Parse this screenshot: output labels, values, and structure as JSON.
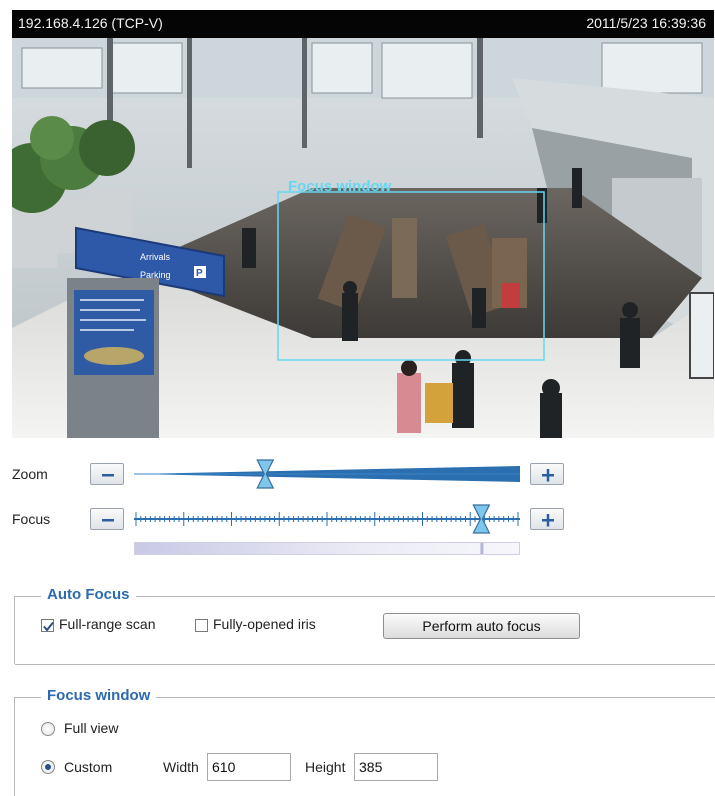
{
  "viewer": {
    "ip_label": "192.168.4.126 (TCP-V)",
    "timestamp": "2011/5/23 16:39:36",
    "focus_window_label": "Focus window",
    "signs": {
      "arrivals": "Arrivals",
      "parking": "Parking"
    }
  },
  "zoom": {
    "label": "Zoom",
    "level": 0.34
  },
  "focus": {
    "label": "Focus",
    "level": 0.9,
    "tick_count": 8
  },
  "auto_focus": {
    "legend": "Auto Focus",
    "full_range_scan": {
      "label": "Full-range scan",
      "checked": true
    },
    "fully_opened_iris": {
      "label": "Fully-opened iris",
      "checked": false
    },
    "perform_button": "Perform auto focus"
  },
  "focus_window": {
    "legend": "Focus window",
    "full_view_label": "Full view",
    "custom_label": "Custom",
    "selected": "custom",
    "width_label": "Width",
    "width_value": "610",
    "height_label": "Height",
    "height_value": "385"
  },
  "colors": {
    "accent": "#2d6ab0",
    "slider": "#2b6fb0",
    "overlay": "#66d7f2"
  }
}
